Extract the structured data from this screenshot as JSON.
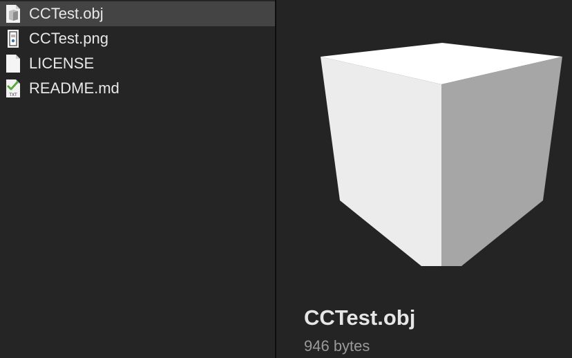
{
  "files": [
    {
      "name": "CCTest.obj",
      "icon": "obj-file-icon",
      "selected": true
    },
    {
      "name": "CCTest.png",
      "icon": "png-file-icon",
      "selected": false
    },
    {
      "name": "LICENSE",
      "icon": "blank-document-icon",
      "selected": false
    },
    {
      "name": "README.md",
      "icon": "txt-file-icon",
      "selected": false
    }
  ],
  "preview": {
    "name": "CCTest.obj",
    "size": "946 bytes",
    "thumbnail_icon": "cube-preview"
  },
  "icons": {
    "txt_badge": "TXT"
  },
  "colors": {
    "background": "#242424",
    "selection": "#444444",
    "text": "#e8e8e8",
    "secondary_text": "#9a9a9a",
    "cube_top": "#ffffff",
    "cube_left": "#ececec",
    "cube_right": "#a6a6a6"
  }
}
